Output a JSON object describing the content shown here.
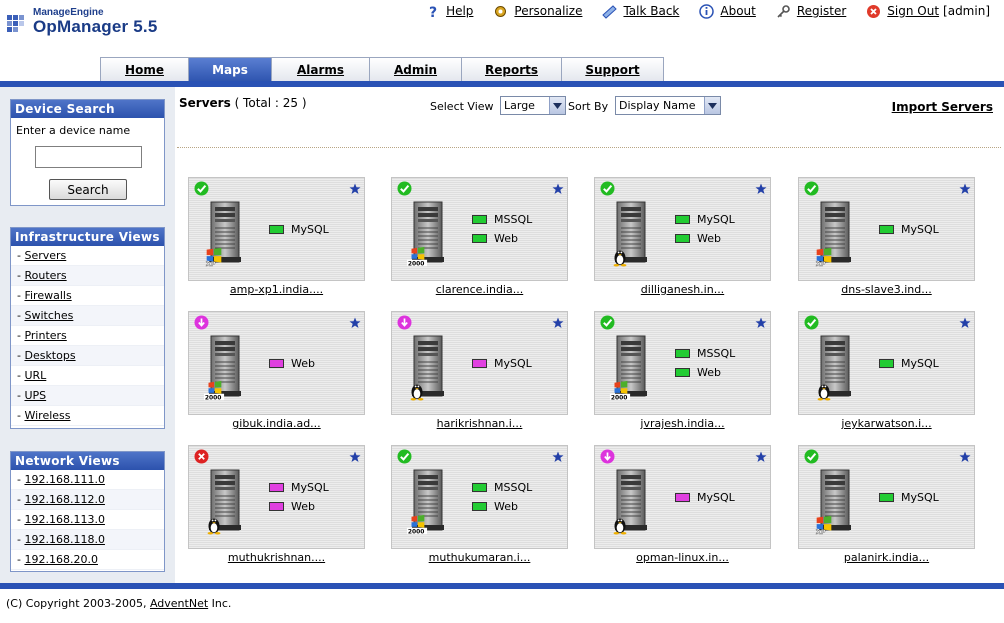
{
  "app": {
    "logo_small": "ManageEngine",
    "logo_big": "OpManager 5.5"
  },
  "top_links": [
    {
      "label": "Help",
      "icon": "help-icon"
    },
    {
      "label": "Personalize",
      "icon": "personalize-icon"
    },
    {
      "label": "Talk Back",
      "icon": "talk-back-icon"
    },
    {
      "label": "About",
      "icon": "info-icon"
    },
    {
      "label": "Register",
      "icon": "key-icon"
    },
    {
      "label": "Sign Out",
      "icon": "sign-out-icon"
    }
  ],
  "signed_in_user": "[admin]",
  "tabs": [
    {
      "label": "Home",
      "active": false
    },
    {
      "label": "Maps",
      "active": true
    },
    {
      "label": "Alarms",
      "active": false
    },
    {
      "label": "Admin",
      "active": false
    },
    {
      "label": "Reports",
      "active": false
    },
    {
      "label": "Support",
      "active": false
    }
  ],
  "device_search": {
    "title": "Device Search",
    "label": "Enter a device name",
    "value": "",
    "button": "Search"
  },
  "infrastructure_views": {
    "title": "Infrastructure Views",
    "items": [
      "Servers",
      "Routers",
      "Firewalls",
      "Switches",
      "Printers",
      "Desktops",
      "URL",
      "UPS",
      "Wireless"
    ]
  },
  "network_views": {
    "title": "Network Views",
    "items": [
      "192.168.111.0",
      "192.168.112.0",
      "192.168.113.0",
      "192.168.118.0",
      "192.168.20.0"
    ]
  },
  "main": {
    "title": "Servers",
    "total": "( Total : 25 )",
    "select_view_label": "Select View",
    "select_view_value": "Large",
    "sort_by_label": "Sort By",
    "sort_by_value": "Display Name",
    "import_link": "Import Servers"
  },
  "colors": {
    "brand_blue": "#2a52b5",
    "monitor_up": "#22cc33",
    "monitor_other": "#e040e0",
    "status_clear": "#22bb22",
    "status_down": "#dd2222",
    "status_attention": "#dd33dd"
  },
  "servers": [
    {
      "name": "amp-xp1.india....",
      "status": "clear",
      "os": "windows-xp",
      "monitors": [
        {
          "label": "MySQL",
          "color": "#22cc33"
        }
      ]
    },
    {
      "name": "clarence.india...",
      "status": "clear",
      "os": "windows-2000",
      "monitors": [
        {
          "label": "MSSQL",
          "color": "#22cc33"
        },
        {
          "label": "Web",
          "color": "#22cc33"
        }
      ]
    },
    {
      "name": "dilliganesh.in...",
      "status": "clear",
      "os": "linux",
      "monitors": [
        {
          "label": "MySQL",
          "color": "#22cc33"
        },
        {
          "label": "Web",
          "color": "#22cc33"
        }
      ]
    },
    {
      "name": "dns-slave3.ind...",
      "status": "clear",
      "os": "windows-xp",
      "monitors": [
        {
          "label": "MySQL",
          "color": "#22cc33"
        }
      ]
    },
    {
      "name": "gibuk.india.ad...",
      "status": "attention",
      "os": "windows-2000",
      "monitors": [
        {
          "label": "Web",
          "color": "#e040e0"
        }
      ]
    },
    {
      "name": "harikrishnan.i...",
      "status": "attention",
      "os": "linux",
      "monitors": [
        {
          "label": "MySQL",
          "color": "#e040e0"
        }
      ]
    },
    {
      "name": "jvrajesh.india...",
      "status": "clear",
      "os": "windows-2000",
      "monitors": [
        {
          "label": "MSSQL",
          "color": "#22cc33"
        },
        {
          "label": "Web",
          "color": "#22cc33"
        }
      ]
    },
    {
      "name": "jeykarwatson.i...",
      "status": "clear",
      "os": "linux",
      "monitors": [
        {
          "label": "MySQL",
          "color": "#22cc33"
        }
      ]
    },
    {
      "name": "muthukrishnan....",
      "status": "down",
      "os": "linux",
      "monitors": [
        {
          "label": "MySQL",
          "color": "#e040e0"
        },
        {
          "label": "Web",
          "color": "#e040e0"
        }
      ]
    },
    {
      "name": "muthukumaran.i...",
      "status": "clear",
      "os": "windows-2000",
      "monitors": [
        {
          "label": "MSSQL",
          "color": "#22cc33"
        },
        {
          "label": "Web",
          "color": "#22cc33"
        }
      ]
    },
    {
      "name": "opman-linux.in...",
      "status": "attention",
      "os": "linux",
      "monitors": [
        {
          "label": "MySQL",
          "color": "#e040e0"
        }
      ]
    },
    {
      "name": "palanirk.india...",
      "status": "clear",
      "os": "windows-xp",
      "monitors": [
        {
          "label": "MySQL",
          "color": "#22cc33"
        }
      ]
    }
  ],
  "footer": {
    "copyright": "(C) Copyright 2003-2005,",
    "company_link": "AdventNet",
    "suffix": "Inc."
  }
}
